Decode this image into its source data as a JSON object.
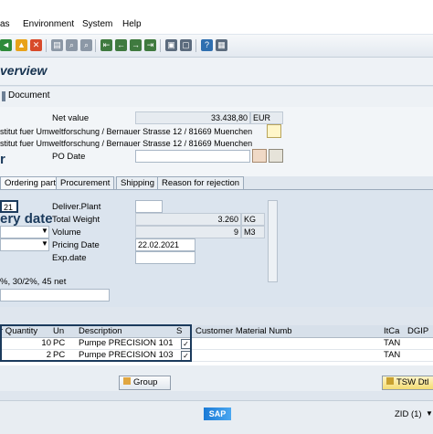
{
  "menu": {
    "items": [
      "as",
      "Environment",
      "System",
      "Help"
    ]
  },
  "title": "verview",
  "appbar": {
    "document_btn": "Document"
  },
  "header": {
    "net_value_label": "Net value",
    "net_value": "33.438,80",
    "currency": "EUR",
    "address_1": "stitut fuer Umweltforschung / Bernauer Strasse 12 / 81669 Muenchen",
    "address_2": "stitut fuer Umweltforschung / Bernauer Strasse 12 / 81669 Muenchen",
    "po_date_label": "PO Date",
    "big_fragment": "r"
  },
  "tabs": [
    "Ordering party",
    "Procurement",
    "Shipping",
    "Reason for rejection"
  ],
  "panel": {
    "item_field": "21",
    "delivery_date_fragment": "ery date",
    "deliver_plant_label": "Deliver.Plant",
    "total_weight_label": "Total Weight",
    "total_weight": "3.260",
    "weight_unit": "KG",
    "volume_label": "Volume",
    "volume": "9",
    "volume_unit": "M3",
    "pricing_date_label": "Pricing Date",
    "pricing_date": "22.02.2021",
    "exp_date_label": "Exp.date",
    "payment_terms": "%, 30/2%, 45 net"
  },
  "grid": {
    "headers": [
      "r Quantity",
      "Un",
      "Description",
      "S",
      "Customer Material Numb",
      "ItCa",
      "DGIP"
    ],
    "rows": [
      {
        "qty": "10",
        "un": "PC",
        "desc": "Pumpe PRECISION 101",
        "checked": "✓",
        "itca": "TAN"
      },
      {
        "qty": "2",
        "un": "PC",
        "desc": "Pumpe PRECISION 103",
        "checked": "✓",
        "itca": "TAN"
      }
    ]
  },
  "buttons": {
    "group": "Group",
    "tsw": "TSW Dtl"
  },
  "status": {
    "brand": "SAP",
    "system": "ZID (1)"
  }
}
